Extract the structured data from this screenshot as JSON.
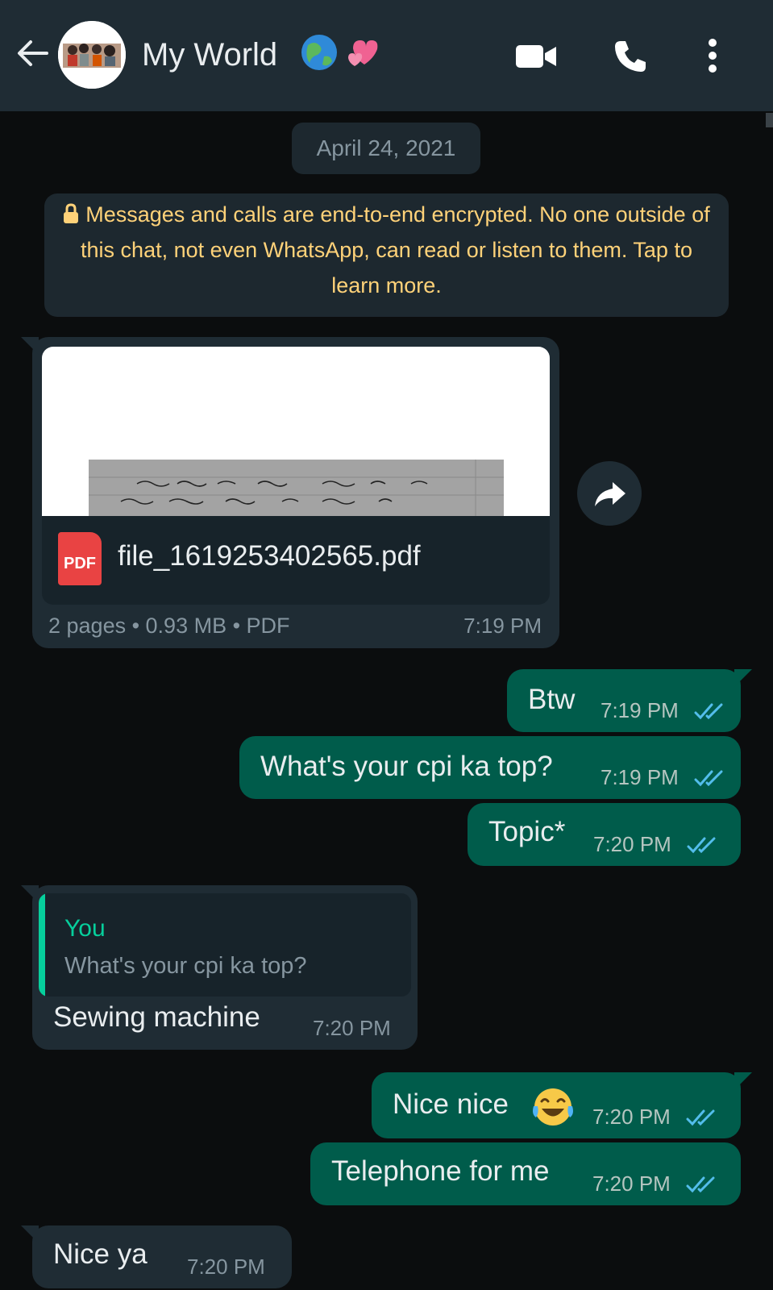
{
  "header": {
    "title": "My World",
    "back_icon": "arrow-left-icon",
    "icons": [
      "video-call-icon",
      "voice-call-icon",
      "more-options-icon"
    ]
  },
  "date_label": "April 24, 2021",
  "encryption_notice": "Messages and calls are end-to-end encrypted. No one outside of this chat, not even WhatsApp, can read or listen to them. Tap to learn more.",
  "document": {
    "file_name": "file_1619253402565.pdf",
    "icon_label": "PDF",
    "meta": "2 pages • 0.93 MB • PDF",
    "time": "7:19 PM"
  },
  "messages": [
    {
      "direction": "out",
      "text": "Btw",
      "time": "7:19 PM",
      "status": "read"
    },
    {
      "direction": "out",
      "text": "What's your cpi ka top?",
      "time": "7:19 PM",
      "status": "read"
    },
    {
      "direction": "out",
      "text": "Topic*",
      "time": "7:20 PM",
      "status": "read"
    },
    {
      "direction": "in",
      "text": "Sewing machine",
      "time": "7:20 PM",
      "quote": {
        "author": "You",
        "text": "What's your cpi ka top?"
      }
    },
    {
      "direction": "out",
      "text": "Nice nice",
      "emoji": "😂",
      "time": "7:20 PM",
      "status": "read"
    },
    {
      "direction": "out",
      "text": "Telephone for me",
      "time": "7:20 PM",
      "status": "read"
    },
    {
      "direction": "in",
      "text": "Nice ya",
      "time": "7:20 PM"
    }
  ],
  "colors": {
    "header_bg": "#1f2c34",
    "chat_bg": "#0b0d0e",
    "incoming_bubble": "#1f2c34",
    "outgoing_bubble": "#005c4b",
    "read_ticks": "#53bdeb",
    "system_text": "#ffd279",
    "quote_accent": "#06cf9c"
  }
}
